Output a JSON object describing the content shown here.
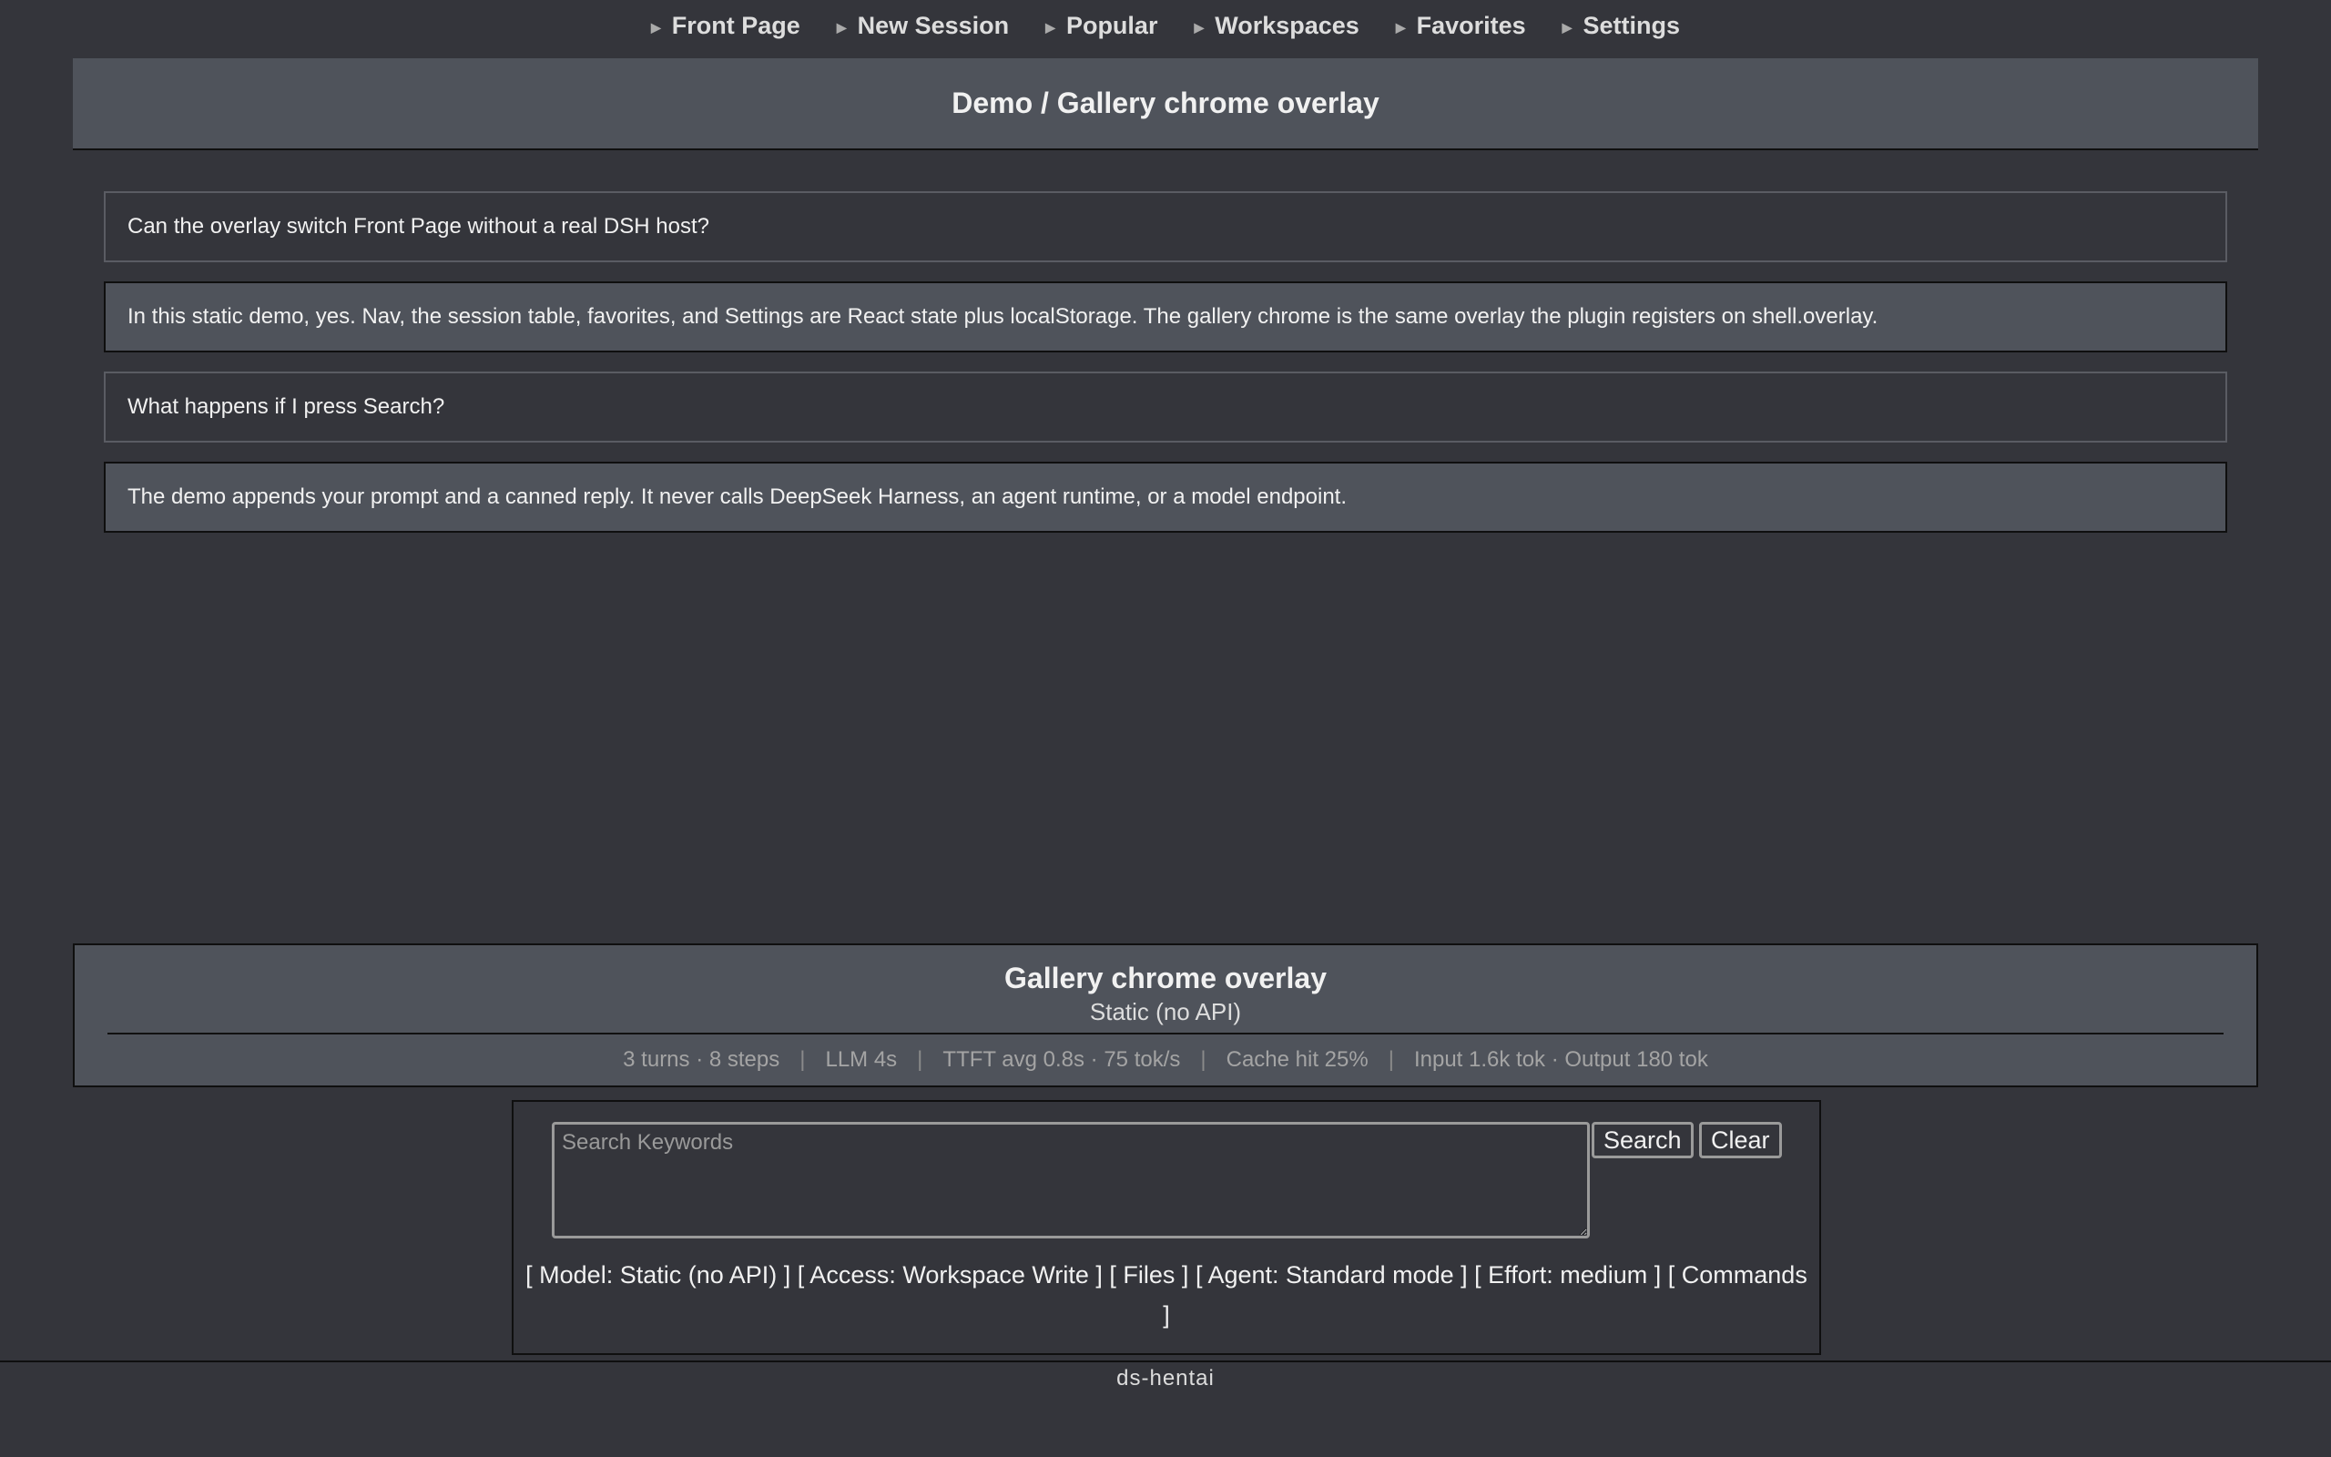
{
  "nav": {
    "items": [
      {
        "label": "Front Page"
      },
      {
        "label": "New Session"
      },
      {
        "label": "Popular"
      },
      {
        "label": "Workspaces"
      },
      {
        "label": "Favorites"
      },
      {
        "label": "Settings"
      }
    ]
  },
  "header": {
    "title": "Demo / Gallery chrome overlay"
  },
  "messages": [
    {
      "role": "user",
      "text": "Can the overlay switch Front Page without a real DSH host?"
    },
    {
      "role": "assistant",
      "text": "In this static demo, yes. Nav, the session table, favorites, and Settings are React state plus localStorage. The gallery chrome is the same overlay the plugin registers on shell.overlay."
    },
    {
      "role": "user",
      "text": "What happens if I press Search?"
    },
    {
      "role": "assistant",
      "text": "The demo appends your prompt and a canned reply. It never calls DeepSeek Harness, an agent runtime, or a model endpoint."
    }
  ],
  "overlay": {
    "title": "Gallery chrome overlay",
    "subtitle": "Static (no API)",
    "stats": [
      "3 turns · 8 steps",
      "LLM 4s",
      "TTFT avg 0.8s · 75 tok/s",
      "Cache hit 25%",
      "Input 1.6k tok · Output 180 tok"
    ],
    "separator": "|"
  },
  "search": {
    "placeholder": "Search Keywords",
    "search_label": "Search",
    "clear_label": "Clear"
  },
  "options": {
    "model": "[ Model: Static (no API) ]",
    "access": "[ Access: Workspace Write ]",
    "files": "[ Files ]",
    "agent": "[ Agent: Standard mode ]",
    "effort": "[ Effort: medium ]",
    "commands": "[ Commands ]"
  },
  "footer": {
    "text": "ds-hentai"
  },
  "colors": {
    "background": "#34353b",
    "panel": "#4f535b",
    "border": "#0f0f0f",
    "text": "#f1f1f1",
    "muted": "#a4a4a4"
  }
}
